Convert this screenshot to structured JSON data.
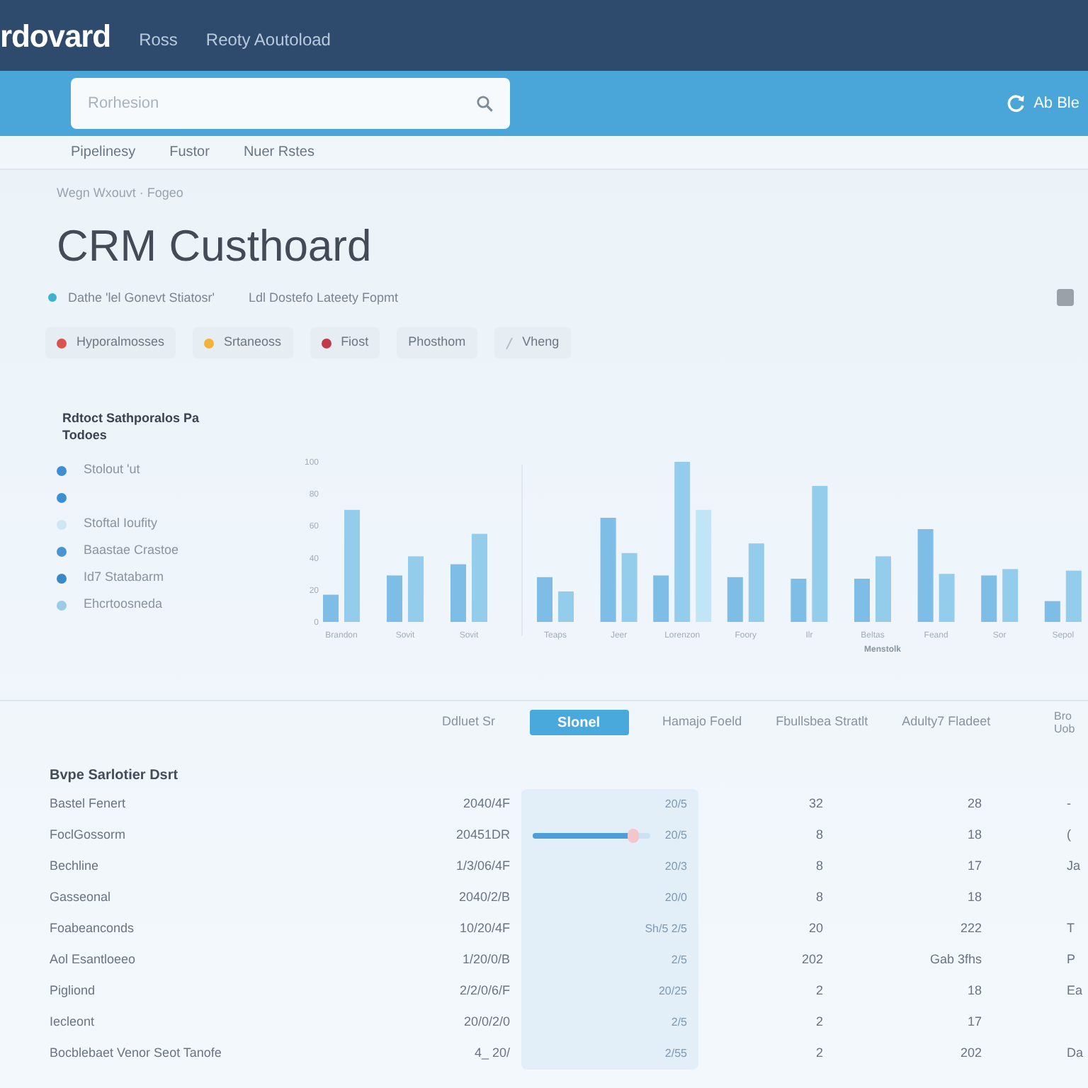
{
  "top_nav": {
    "logo": "rdovard",
    "links": [
      "Ross",
      "Reoty Aoutoload"
    ]
  },
  "search": {
    "placeholder": "Rorhesion"
  },
  "account": {
    "label": "Ab Ble"
  },
  "sub_nav": [
    "Pipelinesy",
    "Fustor",
    "Nuer Rstes"
  ],
  "breadcrumb": "Wegn Wxouvt · Fogeo",
  "title": "CRM Custhoard",
  "subtitle": [
    "Dathe 'lel Gonevt Stiatosr'",
    "Ldl Dostefo Lateety Fopmt"
  ],
  "filters": [
    {
      "label": "Hyporalmosses",
      "kind": "dot",
      "color": "#d9534f"
    },
    {
      "label": "Srtaneoss",
      "kind": "dot",
      "color": "#f2b33d"
    },
    {
      "label": "Fiost",
      "kind": "dot",
      "color": "#c23a4a"
    },
    {
      "label": "Phosthom",
      "kind": "plain"
    },
    {
      "label": "Vheng",
      "kind": "slash"
    }
  ],
  "segments": {
    "title": "Rdtoct Sathporalos Pa Todoes",
    "items": [
      {
        "label": "Stolout 'ut",
        "color": "#3d8fd1"
      },
      {
        "color": "#3d8fd1"
      },
      {
        "label": "Stoftal Ioufity",
        "color": "#cfe6f3"
      },
      {
        "label": "Baastae Crastoe",
        "color": "#4a94d0"
      },
      {
        "label": "Id7 Statabarm",
        "color": "#3b88c8"
      },
      {
        "label": "Ehcrtoosneda",
        "color": "#9ccbe8"
      }
    ]
  },
  "chart_data": {
    "type": "bar",
    "categories": [
      "Brandon",
      "Sovit",
      "Sovit",
      "Teaps",
      "Jeer",
      "Lorenzon",
      "Foory",
      "Ilr",
      "Beltas",
      "Feand",
      "Sor",
      "Sepol"
    ],
    "xlabel": "Menstolk",
    "series": [
      {
        "color": "#7dbde6",
        "values": [
          17,
          29,
          36,
          28,
          65,
          29,
          28,
          27,
          27,
          58,
          29,
          13
        ]
      },
      {
        "color": "#94cdec",
        "values": [
          70,
          41,
          55,
          19,
          43,
          100,
          49,
          85,
          41,
          30,
          33,
          32
        ]
      },
      {
        "color": "#c2e5f6",
        "values": [
          null,
          null,
          null,
          null,
          null,
          70,
          null,
          null,
          null,
          null,
          null,
          null
        ]
      }
    ],
    "ylim": [
      0,
      100
    ],
    "yticks": [
      0,
      20,
      40,
      60,
      80,
      100
    ]
  },
  "table": {
    "tabs": [
      {
        "label": "Ddluet Sr",
        "selected": false
      },
      {
        "label": "Slonel",
        "selected": true
      },
      {
        "label": "Hamajo Foeld",
        "selected": false
      },
      {
        "label": "Fbullsbea Stratlt",
        "selected": false
      },
      {
        "label": "Adulty7 Fladeet",
        "selected": false
      },
      {
        "label": "Bro Uob",
        "selected": false
      }
    ],
    "list_title": "Bvpe Sarlotier Dsrt",
    "rows": [
      {
        "name": "Bastel Fenert",
        "date": "2040/4F",
        "column_2": "20/5",
        "column_3": "32",
        "column_4": "28",
        "column_5": "-"
      },
      {
        "name": "FoclGossorm",
        "date": "20451DR",
        "column_2": "20/5",
        "level": 0.85,
        "column_3": "8",
        "column_4": "18",
        "column_5": "("
      },
      {
        "name": "Bechline",
        "date": "1/3/06/4F",
        "column_2": "20/3",
        "column_3": "8",
        "column_4": "17",
        "column_5": "Ja"
      },
      {
        "name": "Gasseonal",
        "date": "2040/2/B",
        "column_2": "20/0",
        "column_3": "8",
        "column_4": "18"
      },
      {
        "name": "Foabeanconds",
        "date": "10/20/4F",
        "column_2": "Sh/5 2/5",
        "column_3": "20",
        "column_4": "222",
        "column_5": "T"
      },
      {
        "name": "Aol Esantloeeo",
        "date": "1/20/0/B",
        "column_2": "2/5",
        "column_3": "202",
        "column_4": "Gab 3fhs",
        "column_5": "P"
      },
      {
        "name": "Pigliond",
        "date": "2/2/0/6/F",
        "column_2": "20/25",
        "column_3": "2",
        "column_4": "18",
        "column_5": "Ea"
      },
      {
        "name": "Iecleont",
        "date": "20/0/2/0",
        "column_2": "2/5",
        "column_3": "2",
        "column_4": "17"
      },
      {
        "name": "Bocblebaet Venor Seot Tanofe",
        "date": "4_ 20/",
        "column_2": "2/55",
        "column_3": "2",
        "column_4": "202",
        "column_5": "Da"
      }
    ]
  }
}
